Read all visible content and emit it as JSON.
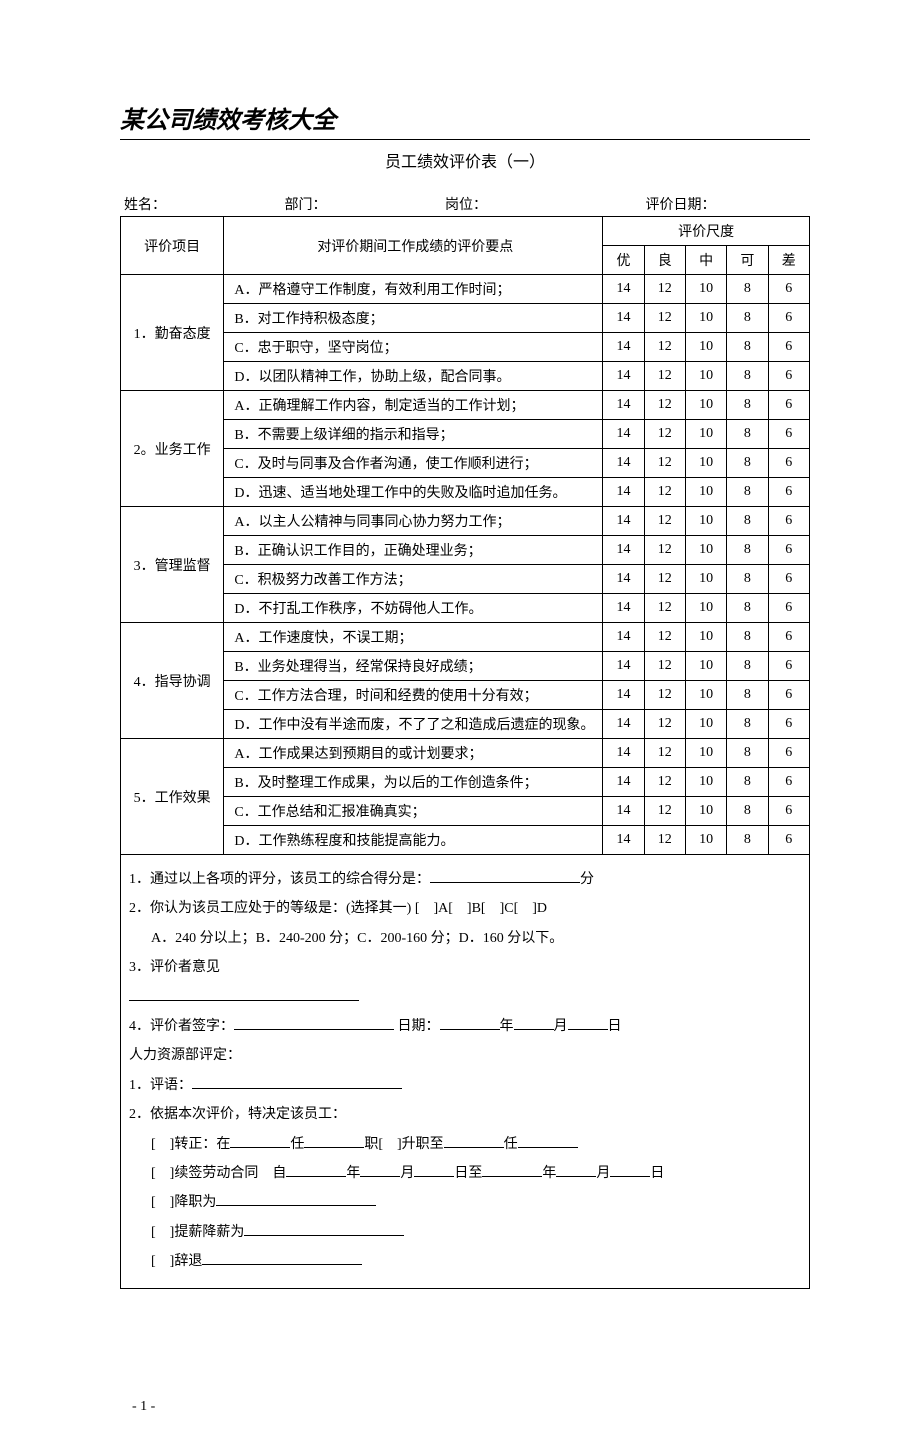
{
  "doc_title": "某公司绩效考核大全",
  "subtitle": "员工绩效评价表（一）",
  "info": {
    "name_label": "姓名：",
    "dept_label": "部门：",
    "post_label": "岗位：",
    "date_label": "评价日期："
  },
  "header": {
    "category": "评价项目",
    "criteria": "对评价期间工作成绩的评价要点",
    "scale": "评价尺度",
    "cols": [
      "优",
      "良",
      "中",
      "可",
      "差"
    ]
  },
  "score_values": [
    14,
    12,
    10,
    8,
    6
  ],
  "sections": [
    {
      "name": "1．勤奋态度",
      "items": [
        "A．严格遵守工作制度，有效利用工作时间；",
        "B．对工作持积极态度；",
        "C．忠于职守，坚守岗位；",
        "D．以团队精神工作，协助上级，配合同事。"
      ]
    },
    {
      "name": "2。业务工作",
      "items": [
        "A．正确理解工作内容，制定适当的工作计划；",
        "B．不需要上级详细的指示和指导；",
        "C．及时与同事及合作者沟通，使工作顺利进行；",
        "D．迅速、适当地处理工作中的失败及临时追加任务。"
      ]
    },
    {
      "name": "3．管理监督",
      "items": [
        "A．以主人公精神与同事同心协力努力工作；",
        "B．正确认识工作目的，正确处理业务；",
        "C．积极努力改善工作方法；",
        "D．不打乱工作秩序，不妨碍他人工作。"
      ]
    },
    {
      "name": "4．指导协调",
      "items": [
        "A．工作速度快，不误工期；",
        "B．业务处理得当，经常保持良好成绩；",
        "C．工作方法合理，时间和经费的使用十分有效；",
        "D．工作中没有半途而废，不了了之和造成后遗症的现象。"
      ]
    },
    {
      "name": "5．工作效果",
      "items": [
        "A．工作成果达到预期目的或计划要求；",
        "B．及时整理工作成果，为以后的工作创造条件；",
        "C．工作总结和汇报准确真实；",
        "D．工作熟练程度和技能提高能力。"
      ]
    }
  ],
  "notes": {
    "line1_a": "1．通过以上各项的评分，该员工的综合得分是：",
    "line1_b": "分",
    "line2": "2．你认为该员工应处于的等级是：(选择其一) [　]A[　]B[　]C[　]D",
    "line2b": "A．240 分以上；B．240-200 分；C．200-160 分；D．160 分以下。",
    "line3": "3．评价者意见",
    "line4a": "4．评价者签字：",
    "line4b": " 日期：",
    "line4c": "年",
    "line4d": "月",
    "line4e": "日",
    "hr_heading": "人力资源部评定：",
    "hr1": "1．评语：",
    "hr2": "2．依据本次评价，特决定该员工：",
    "opt1a": "[　]转正：在",
    "opt1b": "任",
    "opt1c": "职[　]升职至",
    "opt1d": "任",
    "opt2a": "[　]续签劳动合同　自",
    "opt2b": "年",
    "opt2c": "月",
    "opt2d": "日至",
    "opt2e": "年",
    "opt2f": "月",
    "opt2g": "日",
    "opt3": "[　]降职为",
    "opt4": "[　]提薪降薪为",
    "opt5": "[　]辞退"
  },
  "page_number": "- 1 -"
}
